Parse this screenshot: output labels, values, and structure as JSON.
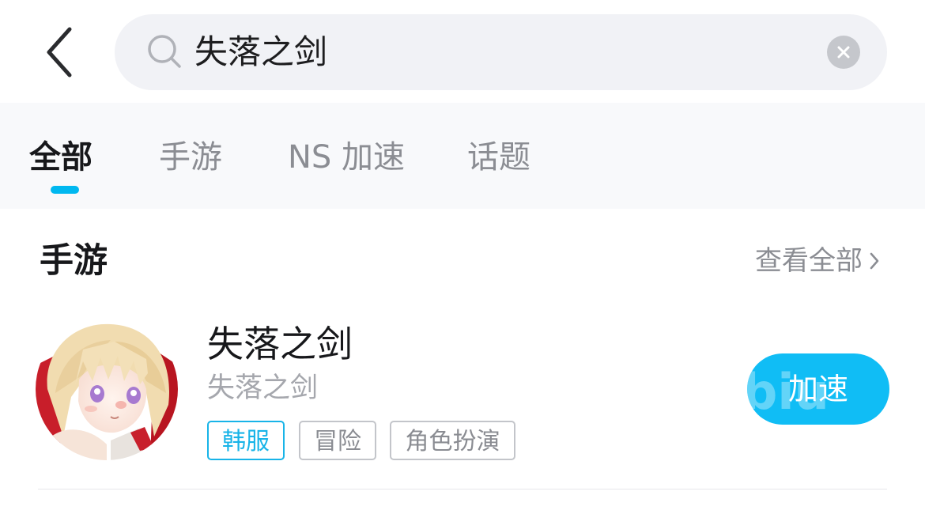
{
  "search": {
    "value": "失落之剑"
  },
  "tabs": [
    {
      "label": "全部",
      "active": true
    },
    {
      "label": "手游",
      "active": false
    },
    {
      "label": "NS 加速",
      "active": false
    },
    {
      "label": "话题",
      "active": false
    }
  ],
  "section": {
    "title": "手游",
    "view_all_label": "查看全部"
  },
  "game": {
    "name": "失落之剑",
    "subname": "失落之剑",
    "tags": [
      {
        "label": "韩服",
        "highlight": true
      },
      {
        "label": "冒险",
        "highlight": false
      },
      {
        "label": "角色扮演",
        "highlight": false
      }
    ],
    "action_label": "加速",
    "button_watermark": "biu"
  },
  "icons": {
    "back": "chevron-left-icon",
    "search": "search-icon",
    "clear": "close-icon",
    "view_all": "chevron-right-icon"
  },
  "colors": {
    "accent": "#10bdf5",
    "tab_indicator": "#00b8f0",
    "search_bg": "#f1f2f6",
    "tag_highlight": "#18b4e8"
  }
}
